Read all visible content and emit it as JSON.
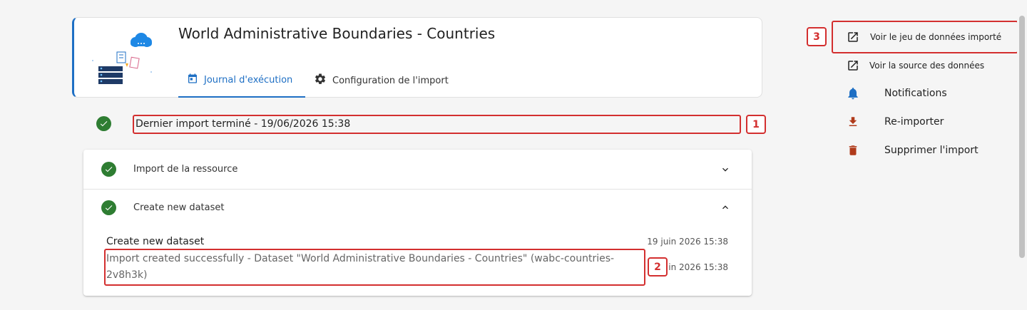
{
  "header": {
    "title": "World Administrative Boundaries - Countries",
    "tabs": [
      {
        "label": "Journal d'exécution",
        "icon": "calendar-icon",
        "active": true
      },
      {
        "label": "Configuration de l'import",
        "icon": "gear-icon",
        "active": false
      }
    ]
  },
  "status": {
    "text": "Dernier import terminé - 19/06/2026 15:38",
    "icon": "check-circle-icon",
    "marker": "1"
  },
  "steps": [
    {
      "label": "Import de la ressource",
      "icon": "check-circle-icon",
      "expanded": false
    },
    {
      "label": "Create new dataset",
      "icon": "check-circle-icon",
      "expanded": true
    }
  ],
  "log": {
    "entries": [
      {
        "text": "Create new dataset",
        "date": "19 juin 2026 15:38"
      },
      {
        "text": "Import created successfully - Dataset \"World Administrative Boundaries - Countries\" (wabc-countries-2v8h3k)",
        "date": "in 2026 15:38"
      }
    ],
    "marker": "2"
  },
  "actions": {
    "marker": "3",
    "items": [
      {
        "label": "Voir le jeu de données importé",
        "icon": "open-in-new-icon"
      },
      {
        "label": "Voir la source des données",
        "icon": "open-in-new-icon"
      },
      {
        "label": "Notifications",
        "icon": "bell-icon"
      },
      {
        "label": "Re-importer",
        "icon": "download-icon"
      },
      {
        "label": "Supprimer l'import",
        "icon": "trash-icon"
      }
    ]
  },
  "colors": {
    "accent": "#1e6fc4",
    "success": "#2e7d32",
    "highlight": "#d32f2f",
    "danger_icon": "#b03a1a"
  }
}
